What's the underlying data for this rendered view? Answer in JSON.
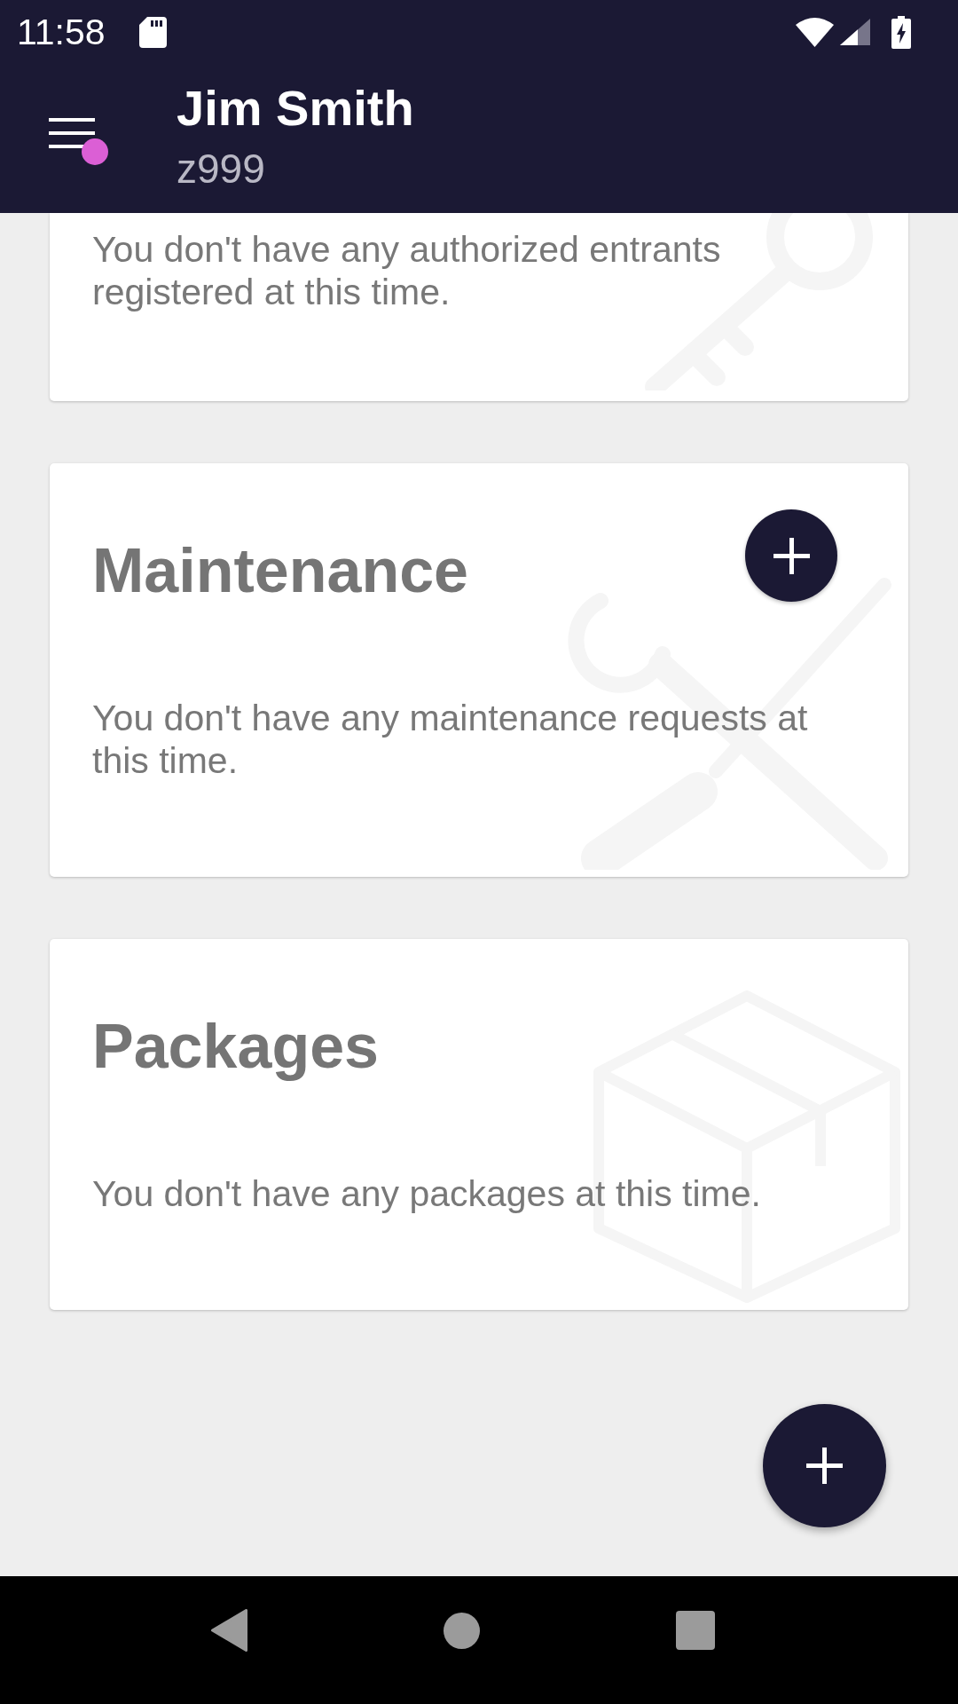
{
  "status_bar": {
    "time": "11:58"
  },
  "app_bar": {
    "title": "Jim Smith",
    "subtitle": "z999",
    "menu_badge": true
  },
  "cards": [
    {
      "kind": "key",
      "message": "You don't have any authorized entrants registered at this time.",
      "add_button": false
    },
    {
      "kind": "tools",
      "title": "Maintenance",
      "message": "You don't have any maintenance requests at this time.",
      "add_button": true
    },
    {
      "kind": "box",
      "title": "Packages",
      "message": "You don't have any packages at this time.",
      "add_button": false
    }
  ]
}
